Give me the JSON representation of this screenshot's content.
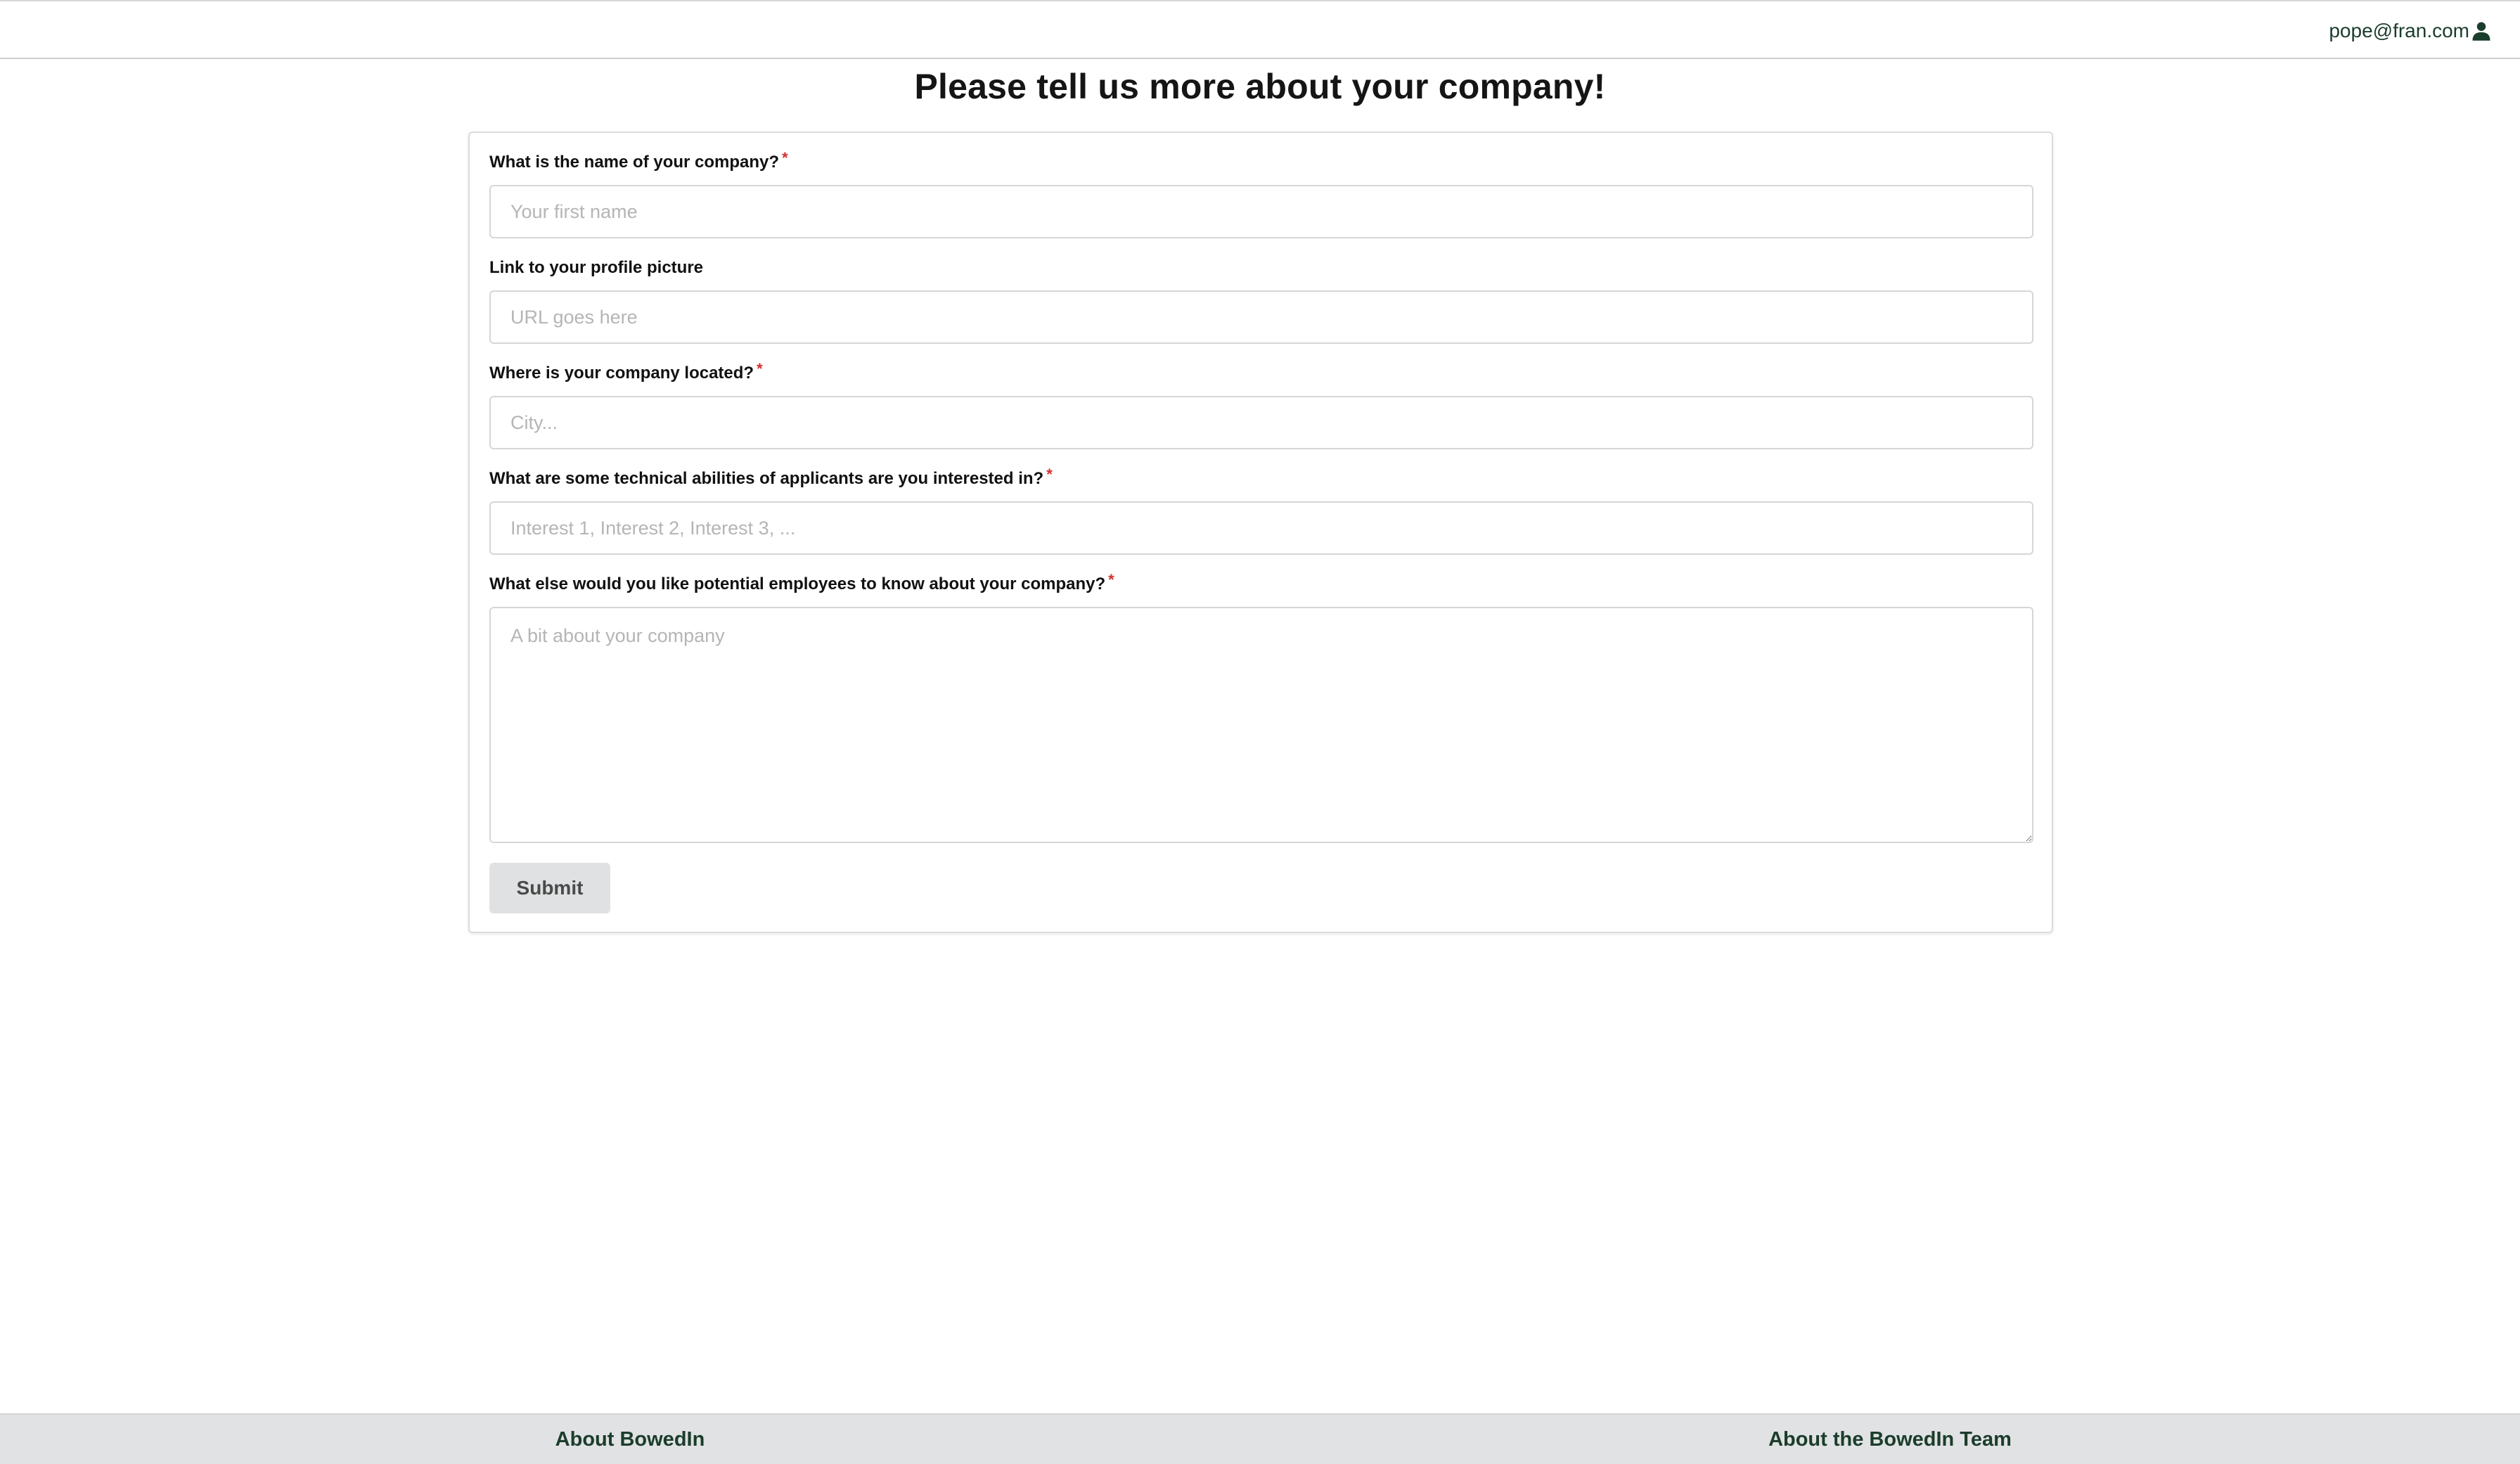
{
  "header": {
    "user_email": "pope@fran.com",
    "user_icon": "user-icon"
  },
  "page": {
    "title": "Please tell us more about your company!"
  },
  "form": {
    "company_name": {
      "label": "What is the name of your company?",
      "required_mark": "*",
      "placeholder": "Your first name",
      "value": ""
    },
    "profile_picture": {
      "label": "Link to your profile picture",
      "placeholder": "URL goes here",
      "value": ""
    },
    "location": {
      "label": "Where is your company located?",
      "required_mark": "*",
      "placeholder": "City...",
      "value": ""
    },
    "interests": {
      "label": "What are some technical abilities of applicants are you interested in?",
      "required_mark": "*",
      "placeholder": "Interest 1, Interest 2, Interest 3, ...",
      "value": ""
    },
    "about": {
      "label": "What else would you like potential employees to know about your company?",
      "required_mark": "*",
      "placeholder": "A bit about your company",
      "value": ""
    },
    "submit_label": "Submit"
  },
  "footer": {
    "about_link": "About BowedIn",
    "team_link": "About the BowedIn Team"
  },
  "colors": {
    "link": "#1b3d2c",
    "required": "#d32f2f",
    "button_bg": "#e0e1e2",
    "footer_bg": "#e1e2e3"
  }
}
